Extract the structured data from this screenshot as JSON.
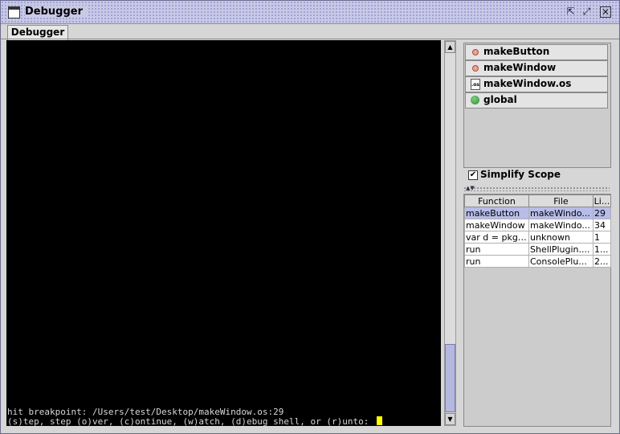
{
  "window": {
    "title": "Debugger",
    "buttons": [
      "minimize-icon",
      "maximize-icon",
      "close-icon"
    ]
  },
  "tabs": [
    {
      "label": "Debugger"
    }
  ],
  "console": {
    "lines": [
      "hit breakpoint: /Users/test/Desktop/makeWindow.os:29",
      "(s)tep, step (o)ver, (c)ontinue, (w)atch, (d)ebug shell, or (r)unto: "
    ]
  },
  "scope": {
    "items": [
      {
        "label": "makeButton",
        "icon": "function-icon"
      },
      {
        "label": "makeWindow",
        "icon": "function-icon"
      },
      {
        "label": "makeWindow.os",
        "icon": "file-icon"
      },
      {
        "label": "global",
        "icon": "globe-icon"
      }
    ],
    "simplify_label": "Simplify Scope",
    "simplify_checked": true
  },
  "stack": {
    "columns": [
      "Function",
      "File",
      "Li..."
    ],
    "rows": [
      {
        "function": "makeButton",
        "file": "makeWindo...",
        "line": "29",
        "selected": true
      },
      {
        "function": "makeWindow",
        "file": "makeWindo...",
        "line": "34",
        "selected": false
      },
      {
        "function": "var d = pkg....",
        "file": "unknown",
        "line": "1",
        "selected": false
      },
      {
        "function": "run",
        "file": "ShellPlugin....",
        "line": "1...",
        "selected": false
      },
      {
        "function": "run",
        "file": "ConsolePlu...",
        "line": "2...",
        "selected": false
      }
    ]
  },
  "colors": {
    "cursor": "#ffff00",
    "selection": "#b8bce8",
    "titlebar": "#c9c9e6"
  }
}
